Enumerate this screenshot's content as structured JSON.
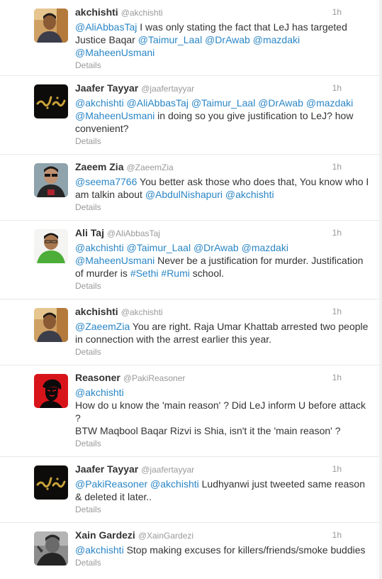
{
  "tweets": [
    {
      "fullname": "akchishti",
      "username": "@akchishti",
      "time": "1h",
      "avatar_icon": "man-portrait-avatar",
      "segments": [
        {
          "type": "mention",
          "text": "@AliAbbasTaj"
        },
        {
          "type": "text",
          "text": " I was only stating the fact that LeJ has targeted Justice Baqar "
        },
        {
          "type": "mention",
          "text": "@Taimur_Laal"
        },
        {
          "type": "text",
          "text": " "
        },
        {
          "type": "mention",
          "text": "@DrAwab"
        },
        {
          "type": "text",
          "text": " "
        },
        {
          "type": "mention",
          "text": "@mazdaki"
        },
        {
          "type": "text",
          "text": " "
        },
        {
          "type": "mention",
          "text": "@MaheenUsmani"
        }
      ],
      "details": "Details"
    },
    {
      "fullname": "Jaafer Tayyar",
      "username": "@jaafertayyar",
      "time": "1h",
      "avatar_icon": "calligraphy-avatar",
      "segments": [
        {
          "type": "mention",
          "text": "@akchishti"
        },
        {
          "type": "text",
          "text": " "
        },
        {
          "type": "mention",
          "text": "@AliAbbasTaj"
        },
        {
          "type": "text",
          "text": " "
        },
        {
          "type": "mention",
          "text": "@Taimur_Laal"
        },
        {
          "type": "text",
          "text": " "
        },
        {
          "type": "mention",
          "text": "@DrAwab"
        },
        {
          "type": "text",
          "text": " "
        },
        {
          "type": "mention",
          "text": "@mazdaki"
        },
        {
          "type": "text",
          "text": " "
        },
        {
          "type": "mention",
          "text": "@MaheenUsmani"
        },
        {
          "type": "text",
          "text": " in doing so you give justification to LeJ? how convenient?"
        }
      ],
      "details": "Details"
    },
    {
      "fullname": "Zaeem Zia",
      "username": "@ZaeemZia",
      "time": "1h",
      "avatar_icon": "man-sunglasses-avatar",
      "segments": [
        {
          "type": "mention",
          "text": "@seema7766"
        },
        {
          "type": "text",
          "text": " You better ask those who does that, You know who I am talkin about "
        },
        {
          "type": "mention",
          "text": "@AbdulNishapuri"
        },
        {
          "type": "text",
          "text": " "
        },
        {
          "type": "mention",
          "text": "@akchishti"
        }
      ],
      "details": "Details"
    },
    {
      "fullname": "Ali Taj",
      "username": "@AliAbbasTaj",
      "time": "1h",
      "avatar_icon": "man-green-shirt-avatar",
      "segments": [
        {
          "type": "mention",
          "text": "@akchishti"
        },
        {
          "type": "text",
          "text": " "
        },
        {
          "type": "mention",
          "text": "@Taimur_Laal"
        },
        {
          "type": "text",
          "text": " "
        },
        {
          "type": "mention",
          "text": "@DrAwab"
        },
        {
          "type": "text",
          "text": " "
        },
        {
          "type": "mention",
          "text": "@mazdaki"
        },
        {
          "type": "text",
          "text": " "
        },
        {
          "type": "mention",
          "text": "@MaheenUsmani"
        },
        {
          "type": "text",
          "text": " Never be a justification for murder. Justification of murder is "
        },
        {
          "type": "hash",
          "text": "#Sethi"
        },
        {
          "type": "text",
          "text": " "
        },
        {
          "type": "hash",
          "text": "#Rumi"
        },
        {
          "type": "text",
          "text": " school."
        }
      ],
      "details": "Details"
    },
    {
      "fullname": "akchishti",
      "username": "@akchishti",
      "time": "1h",
      "avatar_icon": "man-portrait-avatar",
      "segments": [
        {
          "type": "mention",
          "text": "@ZaeemZia"
        },
        {
          "type": "text",
          "text": " You are right. Raja Umar Khattab arrested two people in connection with the arrest earlier this year."
        }
      ],
      "details": "Details"
    },
    {
      "fullname": "Reasoner",
      "username": "@PakiReasoner",
      "time": "1h",
      "avatar_icon": "che-portrait-avatar",
      "segments": [
        {
          "type": "mention",
          "text": "@akchishti"
        },
        {
          "type": "break"
        },
        {
          "type": "text",
          "text": "How do u know the 'main reason' ? Did LeJ inform U before attack ?"
        },
        {
          "type": "break"
        },
        {
          "type": "text",
          "text": "BTW Maqbool Baqar Rizvi is Shia, isn't it the 'main reason' ?"
        }
      ],
      "details": "Details"
    },
    {
      "fullname": "Jaafer Tayyar",
      "username": "@jaafertayyar",
      "time": "1h",
      "avatar_icon": "calligraphy-avatar",
      "segments": [
        {
          "type": "mention",
          "text": "@PakiReasoner"
        },
        {
          "type": "text",
          "text": " "
        },
        {
          "type": "mention",
          "text": "@akchishti"
        },
        {
          "type": "text",
          "text": " Ludhyanwi just tweeted same reason & deleted it later.."
        }
      ],
      "details": "Details"
    },
    {
      "fullname": "Xain Gardezi",
      "username": "@XainGardezi",
      "time": "1h",
      "avatar_icon": "man-grayscale-avatar",
      "segments": [
        {
          "type": "mention",
          "text": "@akchishti"
        },
        {
          "type": "text",
          "text": " Stop making excuses for killers/friends/smoke buddies"
        }
      ],
      "details": "Details"
    }
  ],
  "colors": {
    "link": "#2a86c6",
    "meta": "#999999",
    "text": "#333333",
    "divider": "#e8e8e8"
  }
}
